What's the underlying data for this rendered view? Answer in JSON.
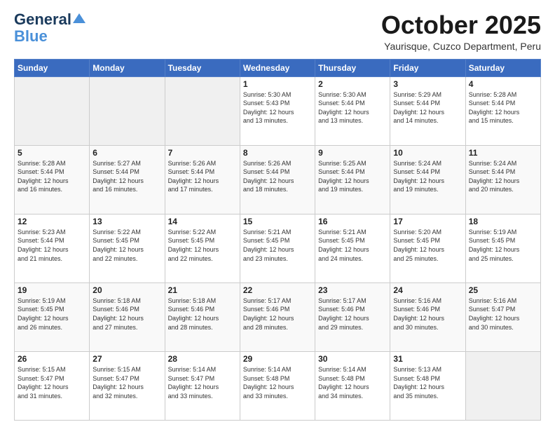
{
  "logo": {
    "line1": "General",
    "line2": "Blue"
  },
  "header": {
    "month": "October 2025",
    "location": "Yaurisque, Cuzco Department, Peru"
  },
  "weekdays": [
    "Sunday",
    "Monday",
    "Tuesday",
    "Wednesday",
    "Thursday",
    "Friday",
    "Saturday"
  ],
  "weeks": [
    [
      {
        "day": "",
        "info": ""
      },
      {
        "day": "",
        "info": ""
      },
      {
        "day": "",
        "info": ""
      },
      {
        "day": "1",
        "info": "Sunrise: 5:30 AM\nSunset: 5:43 PM\nDaylight: 12 hours\nand 13 minutes."
      },
      {
        "day": "2",
        "info": "Sunrise: 5:30 AM\nSunset: 5:44 PM\nDaylight: 12 hours\nand 13 minutes."
      },
      {
        "day": "3",
        "info": "Sunrise: 5:29 AM\nSunset: 5:44 PM\nDaylight: 12 hours\nand 14 minutes."
      },
      {
        "day": "4",
        "info": "Sunrise: 5:28 AM\nSunset: 5:44 PM\nDaylight: 12 hours\nand 15 minutes."
      }
    ],
    [
      {
        "day": "5",
        "info": "Sunrise: 5:28 AM\nSunset: 5:44 PM\nDaylight: 12 hours\nand 16 minutes."
      },
      {
        "day": "6",
        "info": "Sunrise: 5:27 AM\nSunset: 5:44 PM\nDaylight: 12 hours\nand 16 minutes."
      },
      {
        "day": "7",
        "info": "Sunrise: 5:26 AM\nSunset: 5:44 PM\nDaylight: 12 hours\nand 17 minutes."
      },
      {
        "day": "8",
        "info": "Sunrise: 5:26 AM\nSunset: 5:44 PM\nDaylight: 12 hours\nand 18 minutes."
      },
      {
        "day": "9",
        "info": "Sunrise: 5:25 AM\nSunset: 5:44 PM\nDaylight: 12 hours\nand 19 minutes."
      },
      {
        "day": "10",
        "info": "Sunrise: 5:24 AM\nSunset: 5:44 PM\nDaylight: 12 hours\nand 19 minutes."
      },
      {
        "day": "11",
        "info": "Sunrise: 5:24 AM\nSunset: 5:44 PM\nDaylight: 12 hours\nand 20 minutes."
      }
    ],
    [
      {
        "day": "12",
        "info": "Sunrise: 5:23 AM\nSunset: 5:44 PM\nDaylight: 12 hours\nand 21 minutes."
      },
      {
        "day": "13",
        "info": "Sunrise: 5:22 AM\nSunset: 5:45 PM\nDaylight: 12 hours\nand 22 minutes."
      },
      {
        "day": "14",
        "info": "Sunrise: 5:22 AM\nSunset: 5:45 PM\nDaylight: 12 hours\nand 22 minutes."
      },
      {
        "day": "15",
        "info": "Sunrise: 5:21 AM\nSunset: 5:45 PM\nDaylight: 12 hours\nand 23 minutes."
      },
      {
        "day": "16",
        "info": "Sunrise: 5:21 AM\nSunset: 5:45 PM\nDaylight: 12 hours\nand 24 minutes."
      },
      {
        "day": "17",
        "info": "Sunrise: 5:20 AM\nSunset: 5:45 PM\nDaylight: 12 hours\nand 25 minutes."
      },
      {
        "day": "18",
        "info": "Sunrise: 5:19 AM\nSunset: 5:45 PM\nDaylight: 12 hours\nand 25 minutes."
      }
    ],
    [
      {
        "day": "19",
        "info": "Sunrise: 5:19 AM\nSunset: 5:45 PM\nDaylight: 12 hours\nand 26 minutes."
      },
      {
        "day": "20",
        "info": "Sunrise: 5:18 AM\nSunset: 5:46 PM\nDaylight: 12 hours\nand 27 minutes."
      },
      {
        "day": "21",
        "info": "Sunrise: 5:18 AM\nSunset: 5:46 PM\nDaylight: 12 hours\nand 28 minutes."
      },
      {
        "day": "22",
        "info": "Sunrise: 5:17 AM\nSunset: 5:46 PM\nDaylight: 12 hours\nand 28 minutes."
      },
      {
        "day": "23",
        "info": "Sunrise: 5:17 AM\nSunset: 5:46 PM\nDaylight: 12 hours\nand 29 minutes."
      },
      {
        "day": "24",
        "info": "Sunrise: 5:16 AM\nSunset: 5:46 PM\nDaylight: 12 hours\nand 30 minutes."
      },
      {
        "day": "25",
        "info": "Sunrise: 5:16 AM\nSunset: 5:47 PM\nDaylight: 12 hours\nand 30 minutes."
      }
    ],
    [
      {
        "day": "26",
        "info": "Sunrise: 5:15 AM\nSunset: 5:47 PM\nDaylight: 12 hours\nand 31 minutes."
      },
      {
        "day": "27",
        "info": "Sunrise: 5:15 AM\nSunset: 5:47 PM\nDaylight: 12 hours\nand 32 minutes."
      },
      {
        "day": "28",
        "info": "Sunrise: 5:14 AM\nSunset: 5:47 PM\nDaylight: 12 hours\nand 33 minutes."
      },
      {
        "day": "29",
        "info": "Sunrise: 5:14 AM\nSunset: 5:48 PM\nDaylight: 12 hours\nand 33 minutes."
      },
      {
        "day": "30",
        "info": "Sunrise: 5:14 AM\nSunset: 5:48 PM\nDaylight: 12 hours\nand 34 minutes."
      },
      {
        "day": "31",
        "info": "Sunrise: 5:13 AM\nSunset: 5:48 PM\nDaylight: 12 hours\nand 35 minutes."
      },
      {
        "day": "",
        "info": ""
      }
    ]
  ]
}
